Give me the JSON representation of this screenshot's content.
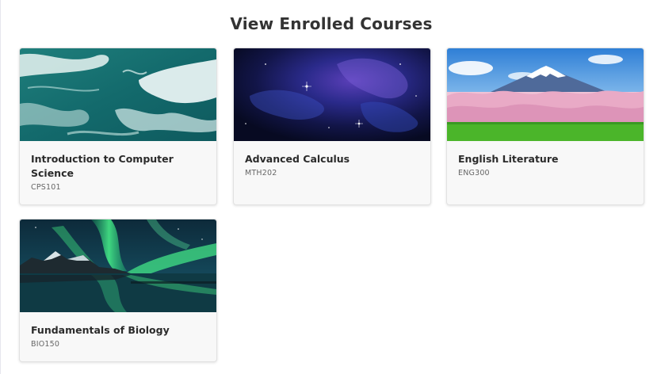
{
  "page": {
    "title": "View Enrolled Courses"
  },
  "courses": [
    {
      "title": "Introduction to Computer Science",
      "code": "CPS101",
      "image": "ocean-waves"
    },
    {
      "title": "Advanced Calculus",
      "code": "MTH202",
      "image": "nebula-space"
    },
    {
      "title": "English Literature",
      "code": "ENG300",
      "image": "mount-fuji-cherry-blossoms"
    },
    {
      "title": "Fundamentals of Biology",
      "code": "BIO150",
      "image": "aurora-borealis"
    }
  ],
  "colors": {
    "title_text": "#333333",
    "card_background": "#f8f8f8",
    "code_text": "#666666"
  }
}
